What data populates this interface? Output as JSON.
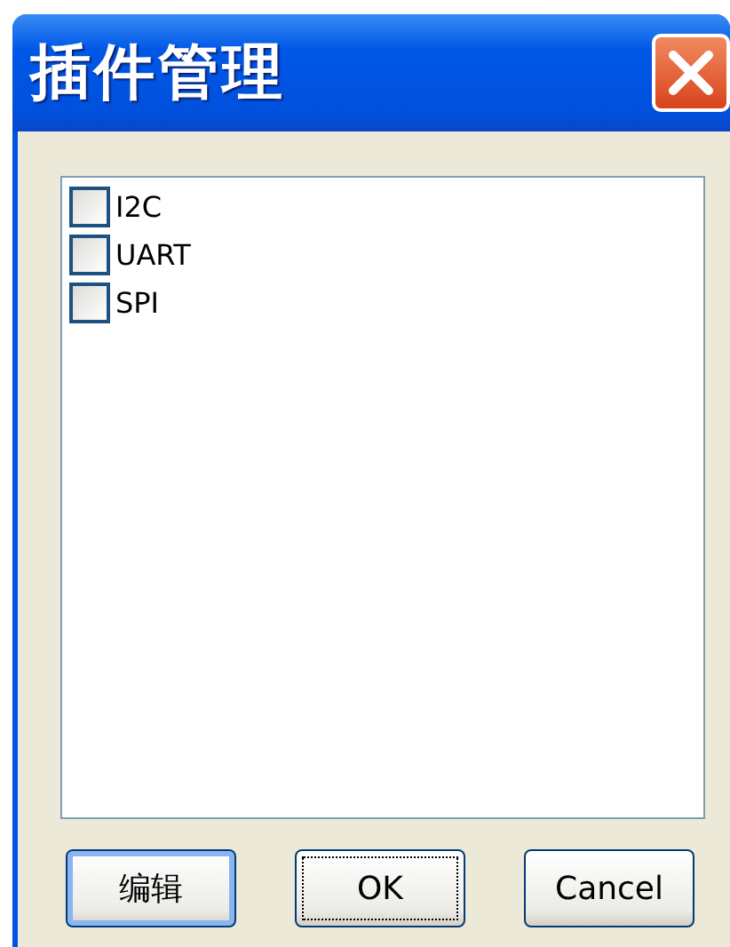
{
  "window": {
    "title": "插件管理"
  },
  "plugins": [
    {
      "label": "I2C",
      "checked": false
    },
    {
      "label": "UART",
      "checked": false
    },
    {
      "label": "SPI",
      "checked": false
    }
  ],
  "buttons": [
    {
      "label": "编辑",
      "hovered": true,
      "focused": false
    },
    {
      "label": "OK",
      "hovered": false,
      "focused": true
    },
    {
      "label": "Cancel",
      "hovered": false,
      "focused": false
    }
  ]
}
